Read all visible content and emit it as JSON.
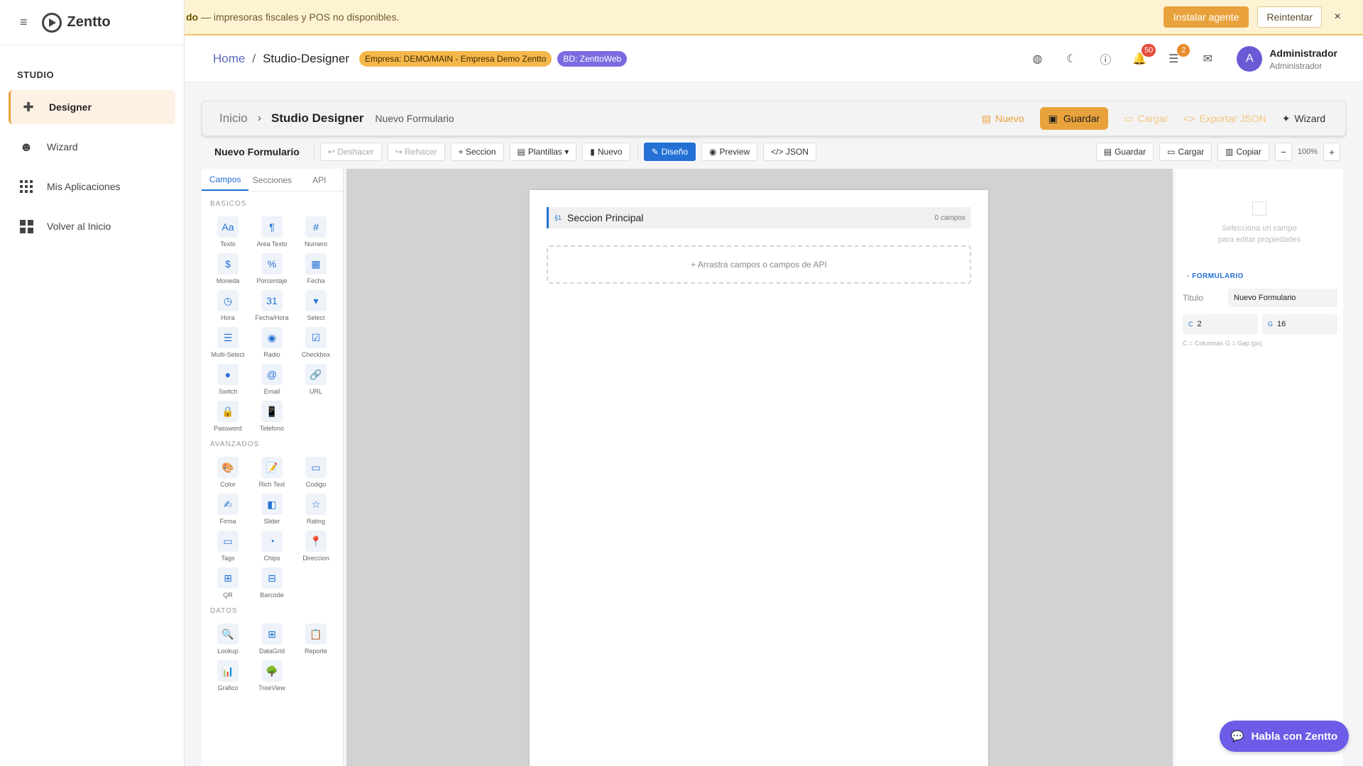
{
  "alert": {
    "text_bold": "do",
    "text": " — impresoras fiscales y POS no disponibles.",
    "install_label": "Instalar agente",
    "retry_label": "Reintentar",
    "close_symbol": "×"
  },
  "sidebar": {
    "brand": "Zentto",
    "section": "STUDIO",
    "items": [
      {
        "label": "Designer",
        "icon": "puzzle-icon"
      },
      {
        "label": "Wizard",
        "icon": "robot-icon"
      },
      {
        "label": "Mis Aplicaciones",
        "icon": "apps-grid-icon"
      },
      {
        "label": "Volver al Inicio",
        "icon": "dashboard-icon"
      }
    ]
  },
  "header": {
    "home": "Home",
    "sep": "/",
    "current": "Studio-Designer",
    "empresa_chip": "Empresa: DEMO/MAIN - Empresa Demo Zentto",
    "bd_chip": "BD: ZenttoWeb",
    "notifications_count": "50",
    "tasks_count": "2",
    "user_initial": "A",
    "user_name": "Administrador",
    "user_role": "Administrador"
  },
  "studio": {
    "inicio": "Inicio",
    "title": "Studio Designer",
    "form_name": "Nuevo Formulario",
    "actions": {
      "nuevo": "Nuevo",
      "guardar": "Guardar",
      "cargar": "Cargar",
      "exportar": "Exportar JSON",
      "wizard": "Wizard"
    }
  },
  "toolbar": {
    "form_title": "Nuevo Formulario",
    "undo": "↩ Deshacer",
    "redo": "↪ Rehacer",
    "add_section": "+ Seccion",
    "templates": "Plantillas ▾",
    "new": "Nuevo",
    "design": "Diseño",
    "preview": "Preview",
    "json": "</> JSON",
    "save": "Guardar",
    "load": "Cargar",
    "copy": "Copiar",
    "zoom": "100%",
    "zoom_out": "−",
    "zoom_in": "+"
  },
  "palette": {
    "tabs": [
      "Campos",
      "Secciones",
      "API"
    ],
    "groups": [
      {
        "title": "BASICOS",
        "items": [
          {
            "label": "Texto",
            "glyph": "Aa"
          },
          {
            "label": "Area Texto",
            "glyph": "¶"
          },
          {
            "label": "Numero",
            "glyph": "#"
          },
          {
            "label": "Moneda",
            "glyph": "$"
          },
          {
            "label": "Porcentaje",
            "glyph": "%"
          },
          {
            "label": "Fecha",
            "glyph": "▦"
          },
          {
            "label": "Hora",
            "glyph": "◷"
          },
          {
            "label": "Fecha/Hora",
            "glyph": "31"
          },
          {
            "label": "Select",
            "glyph": "▾"
          },
          {
            "label": "Multi-Select",
            "glyph": "☰"
          },
          {
            "label": "Radio",
            "glyph": "◉"
          },
          {
            "label": "Checkbox",
            "glyph": "☑"
          },
          {
            "label": "Switch",
            "glyph": "●"
          },
          {
            "label": "Email",
            "glyph": "@"
          },
          {
            "label": "URL",
            "glyph": "🔗"
          },
          {
            "label": "Password",
            "glyph": "🔒"
          },
          {
            "label": "Telefono",
            "glyph": "📱"
          }
        ]
      },
      {
        "title": "AVANZADOS",
        "items": [
          {
            "label": "Color",
            "glyph": "🎨"
          },
          {
            "label": "Rich Text",
            "glyph": "📝"
          },
          {
            "label": "Codigo",
            "glyph": "▭"
          },
          {
            "label": "Firma",
            "glyph": "✍"
          },
          {
            "label": "Slider",
            "glyph": "◧"
          },
          {
            "label": "Rating",
            "glyph": "☆"
          },
          {
            "label": "Tags",
            "glyph": "▭"
          },
          {
            "label": "Chips",
            "glyph": "◔"
          },
          {
            "label": "Direccion",
            "glyph": "📍"
          },
          {
            "label": "QR",
            "glyph": "⊞"
          },
          {
            "label": "Barcode",
            "glyph": "⊟"
          }
        ]
      },
      {
        "title": "DATOS",
        "items": [
          {
            "label": "Lookup",
            "glyph": "🔍"
          },
          {
            "label": "DataGrid",
            "glyph": "⊞"
          },
          {
            "label": "Reporte",
            "glyph": "📋"
          },
          {
            "label": "Grafico",
            "glyph": "📊"
          },
          {
            "label": "TreeView",
            "glyph": "🌳"
          }
        ]
      }
    ]
  },
  "canvas": {
    "section_icon": "§1",
    "section_name": "Seccion Principal",
    "section_count": "0 campos",
    "dropzone": "+ Arrastra campos o campos de API"
  },
  "props": {
    "hint_line1": "Selecciona un campo",
    "hint_line2": "para editar propiedades",
    "heading": "FORMULARIO",
    "title_label": "Titulo",
    "title_value": "Nuevo Formulario",
    "columns_key": "C",
    "columns_value": "2",
    "gap_key": "G",
    "gap_value": "16",
    "footnote": "C = Columnas    G = Gap (px)"
  },
  "chat": {
    "label": "Habla con Zentto"
  }
}
